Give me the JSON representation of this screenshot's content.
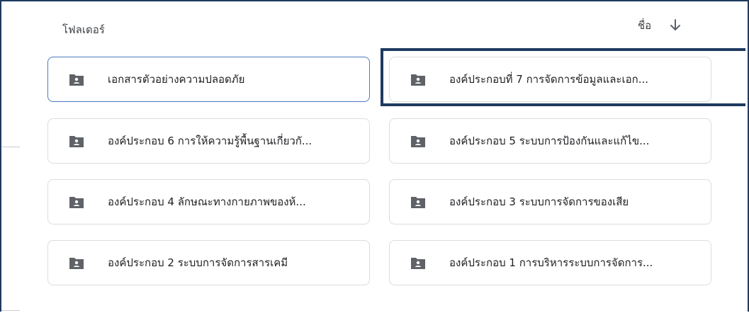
{
  "header": {
    "section_label": "โฟลเดอร์",
    "sort_label": "ชื่อ",
    "sort_icon": "arrow-down-icon"
  },
  "folders": [
    {
      "label": "เอกสารตัวอย่างความปลอดภัย",
      "selected": true
    },
    {
      "label": "องค์ประกอบที่ 7 การจัดการข้อมูลและเอก...",
      "selected": false
    },
    {
      "label": "องค์ประกอบ 6 การให้ความรู้พื้นฐานเกี่ยวกั...",
      "selected": false
    },
    {
      "label": "องค์ประกอบ 5 ระบบการป้องกันและแก้ไข...",
      "selected": false
    },
    {
      "label": "องค์ประกอบ 4 ลักษณะทางกายภาพของห้...",
      "selected": false
    },
    {
      "label": "องค์ประกอบ 3 ระบบการจัดการของเสีย",
      "selected": false
    },
    {
      "label": "องค์ประกอบ 2 ระบบการจัดการสารเคมี",
      "selected": false
    },
    {
      "label": "องค์ประกอบ 1 การบริหารระบบการจัดการ...",
      "selected": false
    }
  ],
  "icons": {
    "folder": "shared-folder-icon"
  },
  "colors": {
    "frame": "#1f3a5f",
    "selected_border": "#4a7cbf",
    "card_border": "#dadce0",
    "folder_icon": "#5f6368"
  }
}
